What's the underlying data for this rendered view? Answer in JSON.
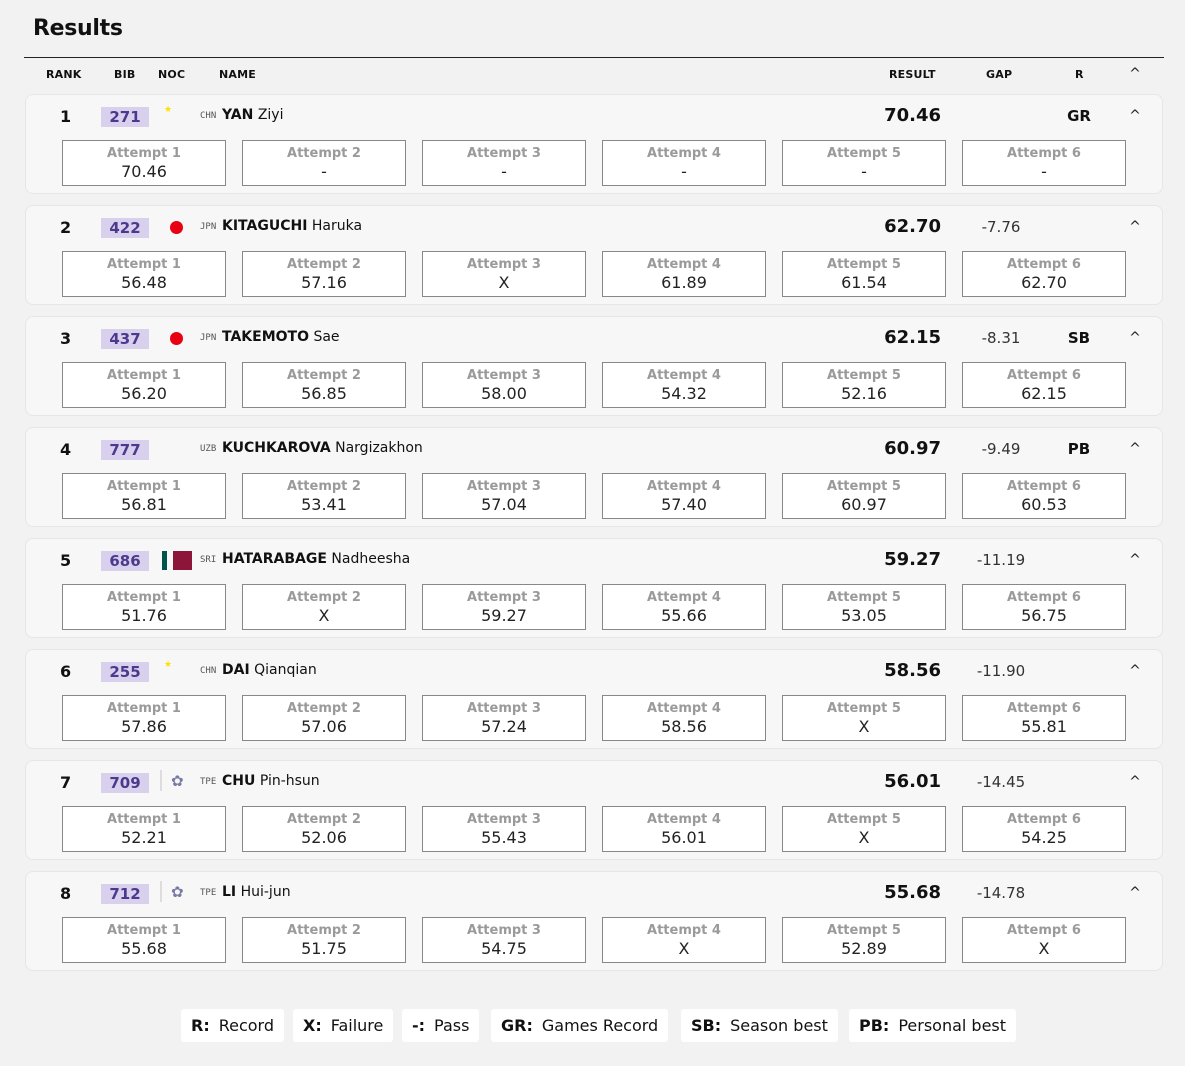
{
  "title": "Results",
  "columns": {
    "rank": "RANK",
    "bib": "BIB",
    "noc": "NOC",
    "name": "NAME",
    "result": "RESULT",
    "gap": "GAP",
    "record": "R"
  },
  "attempt_labels": [
    "Attempt 1",
    "Attempt 2",
    "Attempt 3",
    "Attempt 4",
    "Attempt 5",
    "Attempt 6"
  ],
  "rows": [
    {
      "rank": "1",
      "bib": "271",
      "noc": "CHN",
      "flag": "chn-flag-icon",
      "last": "YAN",
      "first": "Ziyi",
      "result": "70.46",
      "gap": "",
      "record": "GR",
      "attempts": [
        "70.46",
        "-",
        "-",
        "-",
        "-",
        "-"
      ]
    },
    {
      "rank": "2",
      "bib": "422",
      "noc": "JPN",
      "flag": "jpn-flag-icon",
      "last": "KITAGUCHI",
      "first": "Haruka",
      "result": "62.70",
      "gap": "-7.76",
      "record": "",
      "attempts": [
        "56.48",
        "57.16",
        "X",
        "61.89",
        "61.54",
        "62.70"
      ]
    },
    {
      "rank": "3",
      "bib": "437",
      "noc": "JPN",
      "flag": "jpn-flag-icon",
      "last": "TAKEMOTO",
      "first": "Sae",
      "result": "62.15",
      "gap": "-8.31",
      "record": "SB",
      "attempts": [
        "56.20",
        "56.85",
        "58.00",
        "54.32",
        "52.16",
        "62.15"
      ]
    },
    {
      "rank": "4",
      "bib": "777",
      "noc": "UZB",
      "flag": "uzb-flag-icon",
      "last": "KUCHKAROVA",
      "first": "Nargizakhon",
      "result": "60.97",
      "gap": "-9.49",
      "record": "PB",
      "attempts": [
        "56.81",
        "53.41",
        "57.04",
        "57.40",
        "60.97",
        "60.53"
      ]
    },
    {
      "rank": "5",
      "bib": "686",
      "noc": "SRI",
      "flag": "sri-flag-icon",
      "last": "HATARABAGE",
      "first": "Nadheesha",
      "result": "59.27",
      "gap": "-11.19",
      "record": "",
      "attempts": [
        "51.76",
        "X",
        "59.27",
        "55.66",
        "53.05",
        "56.75"
      ]
    },
    {
      "rank": "6",
      "bib": "255",
      "noc": "CHN",
      "flag": "chn-flag-icon",
      "last": "DAI",
      "first": "Qianqian",
      "result": "58.56",
      "gap": "-11.90",
      "record": "",
      "attempts": [
        "57.86",
        "57.06",
        "57.24",
        "58.56",
        "X",
        "55.81"
      ]
    },
    {
      "rank": "7",
      "bib": "709",
      "noc": "TPE",
      "flag": "tpe-flag-icon",
      "last": "CHU",
      "first": "Pin-hsun",
      "result": "56.01",
      "gap": "-14.45",
      "record": "",
      "attempts": [
        "52.21",
        "52.06",
        "55.43",
        "56.01",
        "X",
        "54.25"
      ]
    },
    {
      "rank": "8",
      "bib": "712",
      "noc": "TPE",
      "flag": "tpe-flag-icon",
      "last": "LI",
      "first": "Hui-jun",
      "result": "55.68",
      "gap": "-14.78",
      "record": "",
      "attempts": [
        "55.68",
        "51.75",
        "54.75",
        "X",
        "52.89",
        "X"
      ]
    }
  ],
  "legend": [
    {
      "key": "R:",
      "label": "Record"
    },
    {
      "key": "X:",
      "label": "Failure"
    },
    {
      "key": "-:",
      "label": "Pass"
    },
    {
      "key": "GR:",
      "label": "Games Record"
    },
    {
      "key": "SB:",
      "label": "Season best"
    },
    {
      "key": "PB:",
      "label": "Personal best"
    }
  ],
  "icons": {
    "collapse": "chevron-up-icon"
  }
}
